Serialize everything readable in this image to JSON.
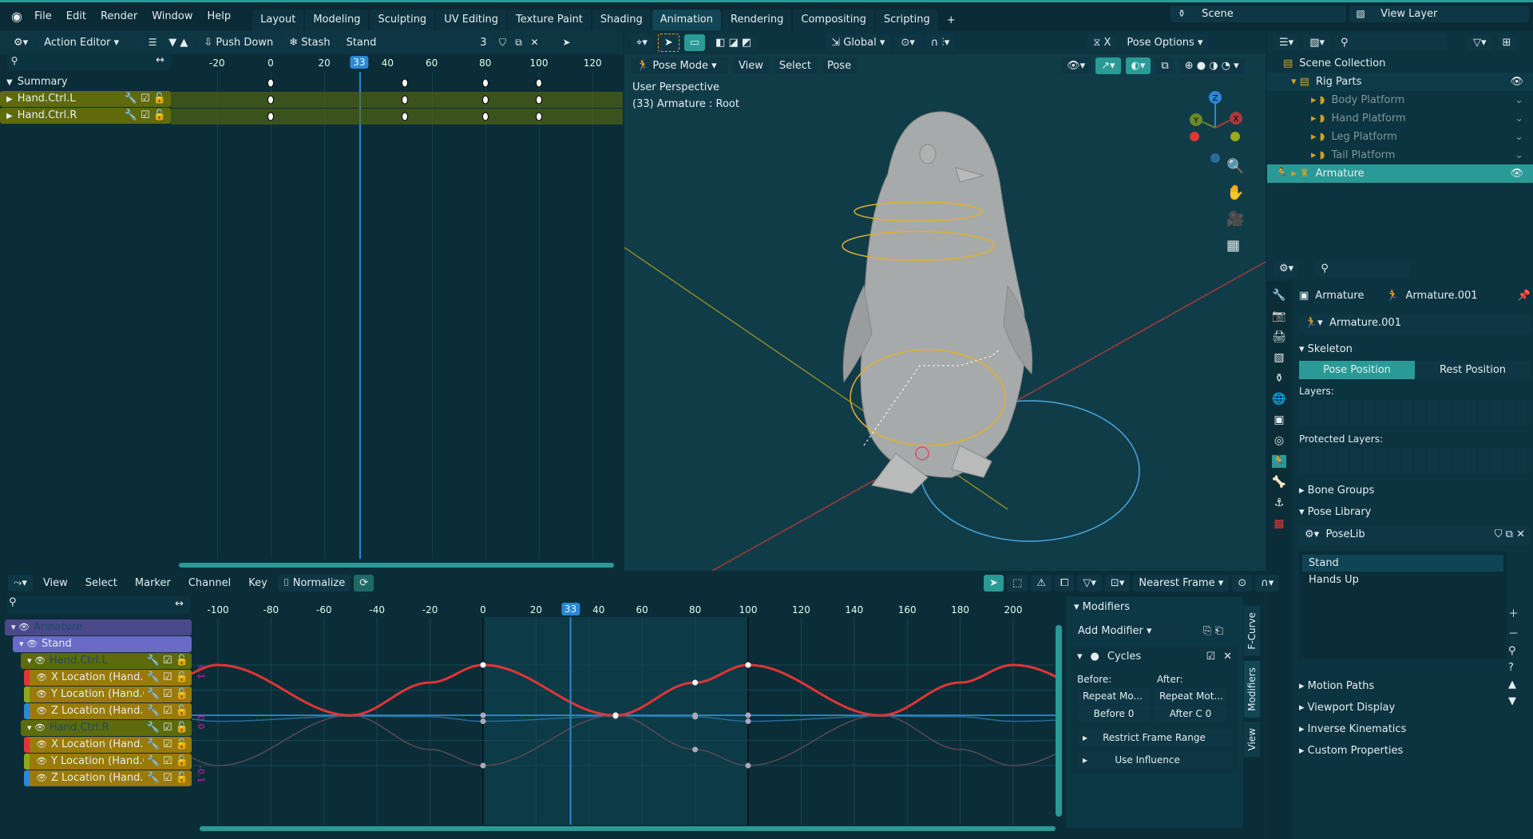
{
  "topbar": {
    "menus": [
      "File",
      "Edit",
      "Render",
      "Window",
      "Help"
    ],
    "tabs": [
      "Layout",
      "Modeling",
      "Sculpting",
      "UV Editing",
      "Texture Paint",
      "Shading",
      "Animation",
      "Rendering",
      "Compositing",
      "Scripting"
    ],
    "active_tab": "Animation",
    "add": "+",
    "scene": "Scene",
    "view_layer": "View Layer"
  },
  "action_editor": {
    "mode": "Action Editor",
    "push_down": "Push Down",
    "stash": "Stash",
    "action": "Stand",
    "users": "3",
    "ticks": [
      -20,
      0,
      20,
      40,
      60,
      80,
      100,
      120
    ],
    "current_frame": "33",
    "channels": [
      "Summary",
      "Hand.Ctrl.L",
      "Hand.Ctrl.R"
    ],
    "keyframes": [
      0,
      50,
      80,
      100
    ]
  },
  "viewport": {
    "mode": "Pose Mode",
    "menus": [
      "View",
      "Select",
      "Pose"
    ],
    "orientation": "Global",
    "pose_options": "Pose Options",
    "info_line1": "User Perspective",
    "info_line2": "(33) Armature : Root",
    "axes": {
      "x": "X",
      "y": "Y",
      "z": "Z"
    }
  },
  "outliner": {
    "items": [
      {
        "label": "Scene Collection"
      },
      {
        "label": "Rig Parts"
      },
      {
        "label": "Body Platform"
      },
      {
        "label": "Hand Platform"
      },
      {
        "label": "Leg Platform"
      },
      {
        "label": "Tail Platform"
      },
      {
        "label": "Armature"
      }
    ]
  },
  "properties": {
    "object": "Armature",
    "data": "Armature.001",
    "data_field": "Armature.001",
    "skeleton": "Skeleton",
    "pose_position": "Pose Position",
    "rest_position": "Rest Position",
    "layers": "Layers:",
    "protected_layers": "Protected Layers:",
    "bone_groups": "Bone Groups",
    "pose_library": "Pose Library",
    "poselib": "PoseLib",
    "poses": [
      "Stand",
      "Hands Up"
    ],
    "sections": [
      "Motion Paths",
      "Viewport Display",
      "Inverse Kinematics",
      "Custom Properties"
    ]
  },
  "graph_editor": {
    "menus": [
      "View",
      "Select",
      "Marker",
      "Channel",
      "Key"
    ],
    "normalize": "Normalize",
    "snap": "Nearest Frame",
    "ticks": [
      -100,
      -80,
      -60,
      -40,
      -20,
      0,
      20,
      40,
      60,
      80,
      100,
      120,
      140,
      160,
      180,
      200
    ],
    "current_frame": "33",
    "value_labels": [
      "0.1",
      "0.0",
      "-0.1"
    ],
    "channels": [
      {
        "label": "Armature",
        "type": "object"
      },
      {
        "label": "Stand",
        "type": "action"
      },
      {
        "label": "Hand.Ctrl.L",
        "type": "group"
      },
      {
        "label": "X Location (Hand.Ctrl.L)",
        "type": "fcurve",
        "color": "#e03535"
      },
      {
        "label": "Y Location (Hand.Ctrl.L)",
        "type": "fcurve",
        "color": "#8fa81a"
      },
      {
        "label": "Z Location (Hand.Ctrl.L)",
        "type": "fcurve",
        "color": "#2a88d8"
      },
      {
        "label": "Hand.Ctrl.R",
        "type": "group"
      },
      {
        "label": "X Location (Hand.Ctrl.R)",
        "type": "fcurve",
        "color": "#e03535"
      },
      {
        "label": "Y Location (Hand.Ctrl.R)",
        "type": "fcurve",
        "color": "#8fa81a"
      },
      {
        "label": "Z Location (Hand.Ctrl.R)",
        "type": "fcurve",
        "color": "#2a88d8"
      }
    ],
    "curves": [
      {
        "name": "X Location (Hand.Ctrl.L)",
        "color": "#e03535",
        "keys": [
          [
            0,
            0.1
          ],
          [
            50,
            0
          ],
          [
            80,
            0.065
          ],
          [
            100,
            0.1
          ]
        ],
        "active": true
      },
      {
        "name": "X Location (Hand.Ctrl.R)",
        "color": "#5a4a55",
        "keys": [
          [
            0,
            -0.1
          ],
          [
            50,
            0
          ],
          [
            80,
            -0.068
          ],
          [
            100,
            -0.1
          ]
        ]
      },
      {
        "name": "Z Location (Hand.Ctrl.R)",
        "color": "#2a6a98",
        "keys": [
          [
            0,
            -0.012
          ],
          [
            50,
            -0.002
          ],
          [
            80,
            -0.003
          ],
          [
            100,
            -0.012
          ]
        ]
      },
      {
        "name": "Z Location (Hand.Ctrl.L)",
        "color": "#3a9ae8",
        "keys": [
          [
            0,
            0
          ],
          [
            50,
            0
          ],
          [
            80,
            0
          ],
          [
            100,
            0
          ]
        ]
      }
    ],
    "modifiers": {
      "title": "Modifiers",
      "add": "Add Modifier",
      "cycles": "Cycles",
      "before": "Before:",
      "after": "After:",
      "before_mode": "Repeat Mo...",
      "after_mode": "Repeat Mot...",
      "before_count": "Before",
      "before_val": "0",
      "after_count": "After C",
      "after_val": "0",
      "restrict": "Restrict Frame Range",
      "influence": "Use Influence"
    },
    "side_tabs": [
      "F-Curve",
      "Modifiers",
      "View"
    ]
  }
}
